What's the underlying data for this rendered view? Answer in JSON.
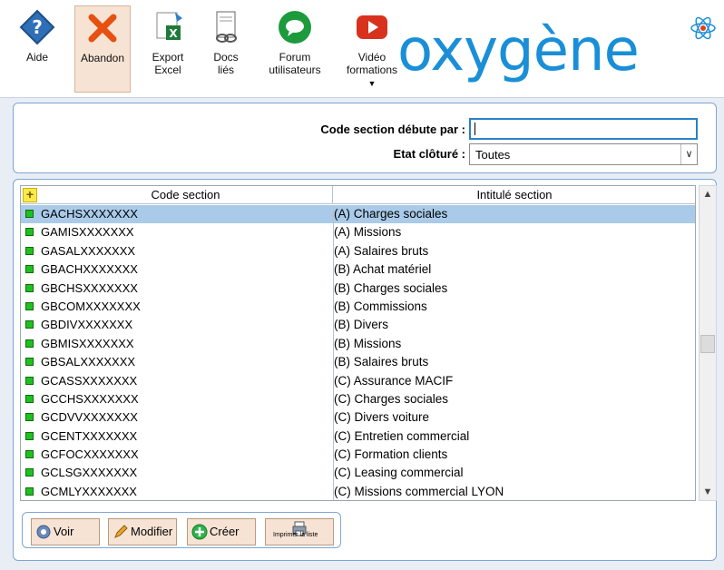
{
  "toolbar": {
    "buttons": [
      {
        "label": "Aide",
        "icon": "help-icon"
      },
      {
        "label": "Abandon",
        "icon": "close-icon"
      },
      {
        "label_line1": "Export",
        "label_line2": "Excel",
        "icon": "excel-icon"
      },
      {
        "label_line1": "Docs",
        "label_line2": "liés",
        "icon": "linked-docs-icon"
      },
      {
        "label_line1": "Forum",
        "label_line2": "utilisateurs",
        "icon": "forum-icon"
      },
      {
        "label_line1": "Vidéo",
        "label_line2": "formations",
        "icon": "video-icon"
      }
    ],
    "logo_text": "oxygène"
  },
  "filter": {
    "code_label": "Code section débute par :",
    "code_value": "",
    "etat_label": "Etat clôturé :",
    "etat_value": "Toutes"
  },
  "table": {
    "col1": "Code section",
    "col2": "Intitulé section",
    "rows": [
      {
        "code": "GACHSXXXXXXX",
        "label": "(A) Charges sociales",
        "selected": true
      },
      {
        "code": "GAMISXXXXXXX",
        "label": "(A) Missions"
      },
      {
        "code": "GASALXXXXXXX",
        "label": "(A) Salaires bruts"
      },
      {
        "code": "GBACHXXXXXXX",
        "label": "(B) Achat matériel"
      },
      {
        "code": "GBCHSXXXXXXX",
        "label": "(B) Charges sociales"
      },
      {
        "code": "GBCOMXXXXXXX",
        "label": "(B) Commissions"
      },
      {
        "code": "GBDIVXXXXXXX",
        "label": "(B) Divers"
      },
      {
        "code": "GBMISXXXXXXX",
        "label": "(B) Missions"
      },
      {
        "code": "GBSALXXXXXXX",
        "label": "(B) Salaires bruts"
      },
      {
        "code": "GCASSXXXXXXX",
        "label": "(C) Assurance MACIF"
      },
      {
        "code": "GCCHSXXXXXXX",
        "label": "(C) Charges sociales"
      },
      {
        "code": "GCDVVXXXXXXX",
        "label": "(C) Divers voiture"
      },
      {
        "code": "GCENTXXXXXXX",
        "label": "(C) Entretien commercial"
      },
      {
        "code": "GCFOCXXXXXXX",
        "label": "(C) Formation clients"
      },
      {
        "code": "GCLSGXXXXXXX",
        "label": "(C) Leasing commercial"
      },
      {
        "code": "GCMLYXXXXXXX",
        "label": "(C) Missions commercial LYON"
      }
    ]
  },
  "actions": {
    "voir": "Voir",
    "modifier": "Modifier",
    "creer": "Créer",
    "imprimer": "Imprimer la liste"
  },
  "colors": {
    "accent": "#1a8fd8",
    "selected_row": "#a9cbe9",
    "status_green": "#20c020",
    "button_bg": "#f6e3d4"
  }
}
